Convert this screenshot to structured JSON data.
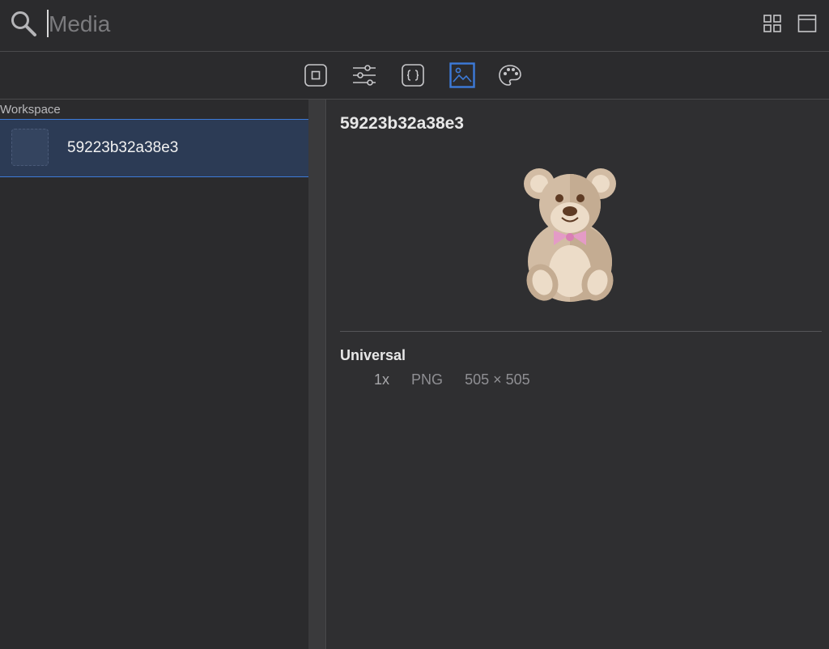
{
  "search": {
    "placeholder": "Media",
    "value": ""
  },
  "toolbar": {
    "tabs": [
      {
        "id": "file",
        "icon": "square-icon",
        "active": false
      },
      {
        "id": "attributes",
        "icon": "sliders-icon",
        "active": false
      },
      {
        "id": "code",
        "icon": "braces-icon",
        "active": false
      },
      {
        "id": "media",
        "icon": "image-icon",
        "active": true
      },
      {
        "id": "color",
        "icon": "palette-icon",
        "active": false
      }
    ]
  },
  "sidebar": {
    "section_label": "Workspace",
    "items": [
      {
        "name": "59223b32a38e3",
        "selected": true
      }
    ]
  },
  "detail": {
    "title": "59223b32a38e3",
    "variant_title": "Universal",
    "variant": {
      "scale": "1x",
      "format": "PNG",
      "size": "505 × 505"
    }
  },
  "colors": {
    "accent": "#3d7bd9",
    "selection": "#2c3b55",
    "background": "#2b2b2d"
  }
}
